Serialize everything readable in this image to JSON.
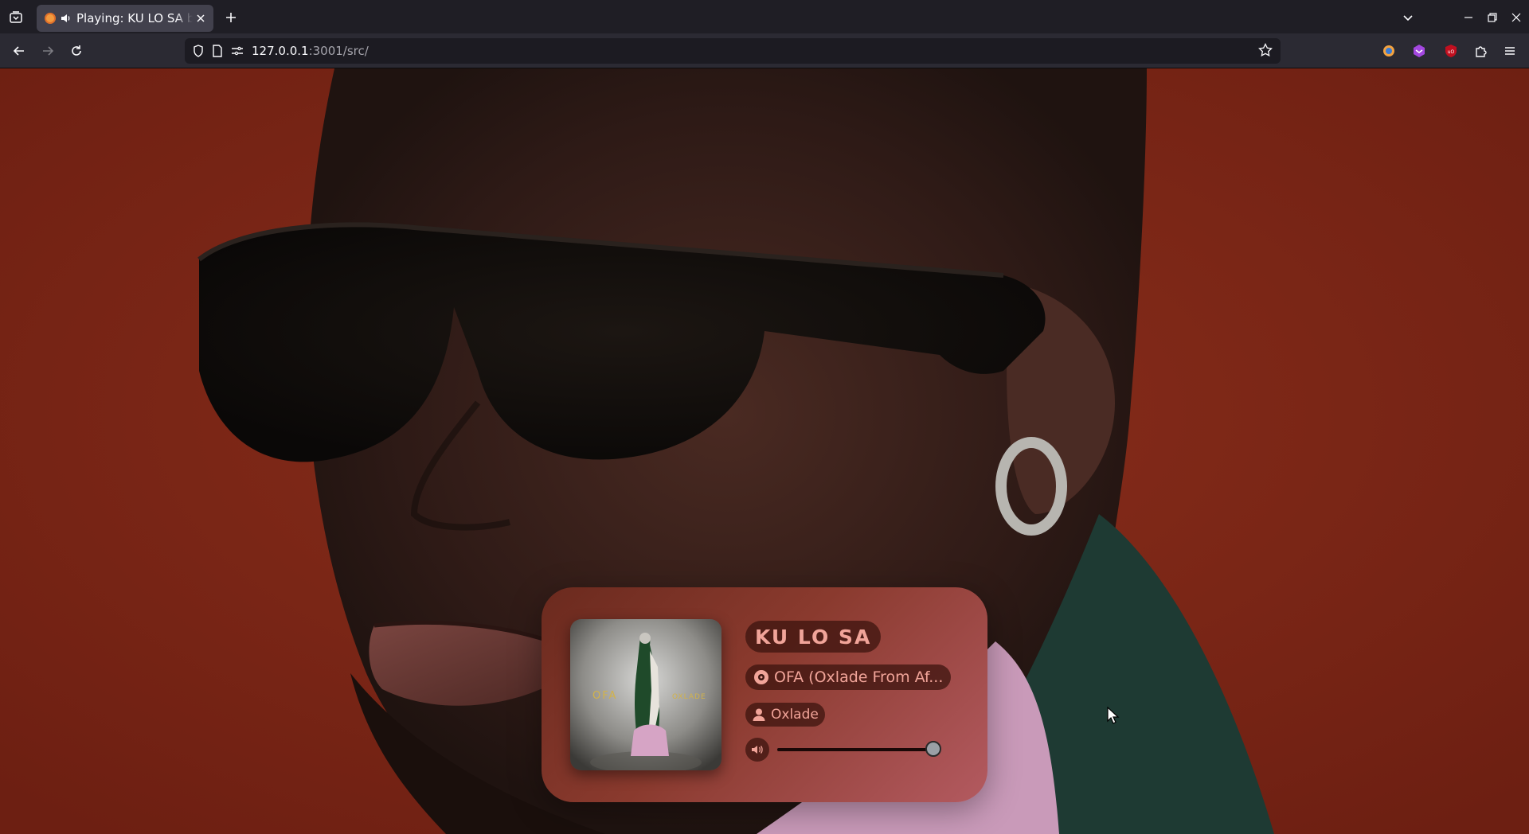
{
  "browser": {
    "tab": {
      "title": "Playing: KU LO SA by Oxlade",
      "accent": "#f29a3e"
    },
    "url": {
      "host": "127.0.0.1",
      "rest": ":3001/src/"
    },
    "icons": {
      "tab_list": "tab-list-icon",
      "audio": "speaker-icon",
      "close": "close-icon",
      "new_tab": "plus-icon",
      "back": "back-arrow-icon",
      "forward": "forward-arrow-icon",
      "reload": "reload-icon",
      "shield": "shield-icon",
      "page": "page-icon",
      "permissions": "permissions-icon",
      "bookmark": "star-icon",
      "extensions": "puzzle-icon",
      "menu": "hamburger-icon"
    }
  },
  "player": {
    "track_title": "KU LO SA",
    "album": "OFA (Oxlade From Af...",
    "artist": "Oxlade",
    "volume": 1.0,
    "cover": {
      "left_text": "OFA",
      "right_text": "OXLADE"
    },
    "colors": {
      "pill_text": "#f1a499",
      "background": "#7b2515"
    }
  }
}
